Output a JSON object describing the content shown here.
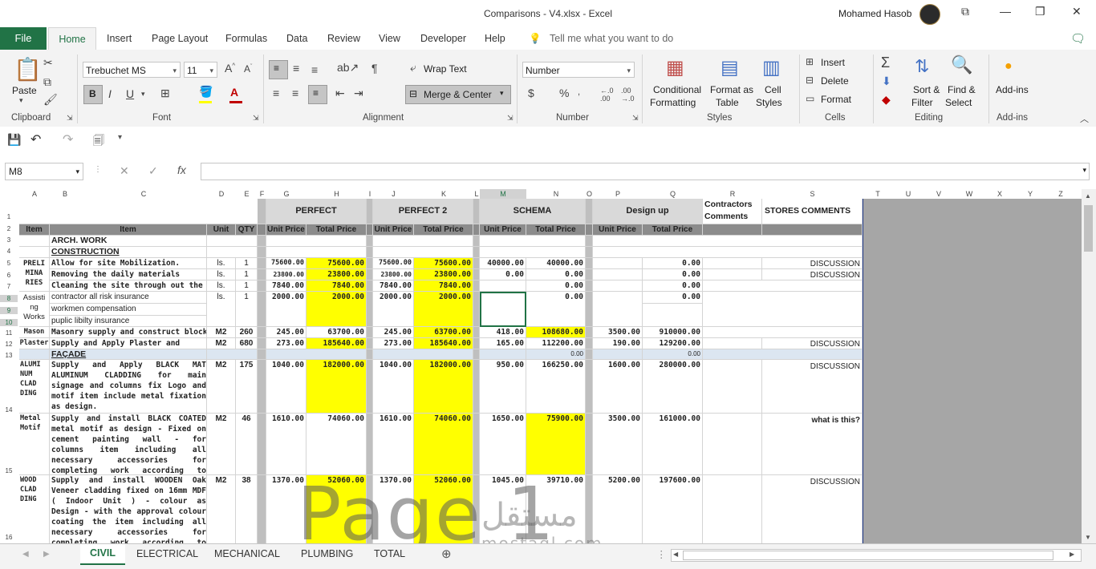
{
  "window": {
    "title": "Comparisons - V4.xlsx  -  Excel",
    "user": "Mohamed Hasob"
  },
  "tabs": [
    "File",
    "Home",
    "Insert",
    "Page Layout",
    "Formulas",
    "Data",
    "Review",
    "View",
    "Developer",
    "Help"
  ],
  "tell_me": "Tell me what you want to do",
  "ribbon": {
    "clipboard": {
      "paste": "Paste",
      "label": "Clipboard"
    },
    "font": {
      "name": "Trebuchet MS",
      "size": "11",
      "bold": "B",
      "italic": "I",
      "underline": "U",
      "label": "Font"
    },
    "alignment": {
      "wrap": "Wrap Text",
      "merge": "Merge & Center",
      "label": "Alignment"
    },
    "number": {
      "format": "Number",
      "currency": "$",
      "percent": "%",
      "label": "Number"
    },
    "styles": {
      "conditional": "Conditional",
      "conditional2": "Formatting",
      "format_as": "Format as",
      "format_as2": "Table",
      "cell": "Cell",
      "cell2": "Styles",
      "label": "Styles"
    },
    "cells": {
      "insert": "Insert",
      "delete": "Delete",
      "format": "Format",
      "label": "Cells"
    },
    "editing": {
      "sort": "Sort &",
      "sort2": "Filter",
      "find": "Find &",
      "find2": "Select",
      "label": "Editing"
    },
    "addins": {
      "btn": "Add-ins",
      "label": "Add-ins"
    }
  },
  "formula_bar": {
    "name_box": "M8",
    "fx": "fx",
    "value": ""
  },
  "columns": [
    "A",
    "B",
    "C",
    "D",
    "E",
    "F",
    "G",
    "H",
    "I",
    "J",
    "K",
    "L",
    "M",
    "N",
    "O",
    "P",
    "Q",
    "R",
    "S",
    "T",
    "U",
    "V",
    "W",
    "X",
    "Y",
    "Z"
  ],
  "rows": [
    "1",
    "2",
    "3",
    "4",
    "5",
    "6",
    "7",
    "8",
    "9",
    "10",
    "11",
    "12",
    "13",
    "14",
    "15",
    "16"
  ],
  "headers": {
    "perfect": "PERFECT",
    "perfect2": "PERFECT 2",
    "schema": "SCHEMA",
    "designup": "Design up",
    "contractors": "Contractors Comments",
    "stores": "STORES COMMENTS",
    "item": "Item",
    "item2": "Item",
    "unit": "Unit",
    "qty": "QTY",
    "unit_price": "Unit Price",
    "total_price": "Total Price"
  },
  "cells": {
    "r3": "ARCH. WORK",
    "r4": "CONSTRUCTION",
    "prelim": "PRELI MINA RIES",
    "r5": {
      "desc": "Allow for site Mobilization.",
      "unit": "ls.",
      "qty": "1",
      "g": "75600.00",
      "h": "75600.00",
      "j": "75600.00",
      "k": "75600.00",
      "m": "40000.00",
      "n": "40000.00",
      "q": "0.00",
      "s": "DISCUSSION"
    },
    "r6": {
      "desc": "Removing the daily materials",
      "unit": "ls.",
      "qty": "1",
      "g": "23800.00",
      "h": "23800.00",
      "j": "23800.00",
      "k": "23800.00",
      "m": "0.00",
      "n": "0.00",
      "q": "0.00",
      "s": "DISCUSSION"
    },
    "r7": {
      "desc": "Cleaning the site through out the",
      "unit": "ls.",
      "qty": "1",
      "g": "7840.00",
      "h": "7840.00",
      "j": "7840.00",
      "k": "7840.00",
      "n": "0.00",
      "q": "0.00"
    },
    "assist": "Assisti ng Works",
    "r8": {
      "desc": "contractor all risk insurance",
      "unit": "ls.",
      "qty": "1",
      "g": "2000.00",
      "h": "2000.00",
      "j": "2000.00",
      "k": "2000.00",
      "n": "0.00",
      "q": "0.00"
    },
    "r9": {
      "desc": "workmen compensation"
    },
    "r10": {
      "desc": "puplic libilty insurance"
    },
    "r11": {
      "item": "Mason",
      "desc": "Masonry supply and construct block",
      "unit": "M2",
      "qty": "260",
      "g": "245.00",
      "h": "63700.00",
      "j": "245.00",
      "k": "63700.00",
      "m": "418.00",
      "n": "108680.00",
      "p": "3500.00",
      "q": "910000.00"
    },
    "r12": {
      "item": "Plaster",
      "desc": "Supply and Apply Plaster and",
      "unit": "M2",
      "qty": "680",
      "g": "273.00",
      "h": "185640.00",
      "j": "273.00",
      "k": "185640.00",
      "m": "165.00",
      "n": "112200.00",
      "p": "190.00",
      "q": "129200.00",
      "s": "DISCUSSION"
    },
    "r13": {
      "desc": "FAÇADE",
      "n": "0.00",
      "q": "0.00"
    },
    "r14": {
      "item": "ALUMI NUM CLAD DING",
      "desc": "Supply and Apply BLACK MAT ALUMINUM CLADDING for main signage and columns fix Logo and motif item include metal fixation as design.",
      "unit": "M2",
      "qty": "175",
      "g": "1040.00",
      "h": "182000.00",
      "j": "1040.00",
      "k": "182000.00",
      "m": "950.00",
      "n": "166250.00",
      "p": "1600.00",
      "q": "280000.00",
      "s": "DISCUSSION"
    },
    "r15": {
      "item": "Metal Motif",
      "desc": "Supply and install BLACK COATED metal motif as design - Fixed on cement painting wall - for columns item including all necessary accessories for completing work according to design drawings.",
      "unit": "M2",
      "qty": "46",
      "g": "1610.00",
      "h": "74060.00",
      "j": "1610.00",
      "k": "74060.00",
      "m": "1650.00",
      "n": "75900.00",
      "p": "3500.00",
      "q": "161000.00",
      "s": "what is this?"
    },
    "r16": {
      "item": "WOOD CLAD DING",
      "desc": "Supply and install WOODEN Oak Veneer cladding fixed on 16mm MDF ( Indoor Unit ) - colour as Design - with the approval colour coating the item including all necessary accessories for completing work according to design drawings.",
      "unit": "M2",
      "qty": "38",
      "g": "1370.00",
      "h": "52060.00",
      "j": "1370.00",
      "k": "52060.00",
      "m": "1045.00",
      "n": "39710.00",
      "p": "5200.00",
      "q": "197600.00",
      "s": "DISCUSSION"
    }
  },
  "sheets": [
    "CIVIL",
    "ELECTRICAL",
    "MECHANICAL",
    "PLUMBING",
    "TOTAL"
  ],
  "watermark": {
    "page": "Page 1",
    "site": "mostaql.com",
    "site_ar": "مستقل"
  }
}
